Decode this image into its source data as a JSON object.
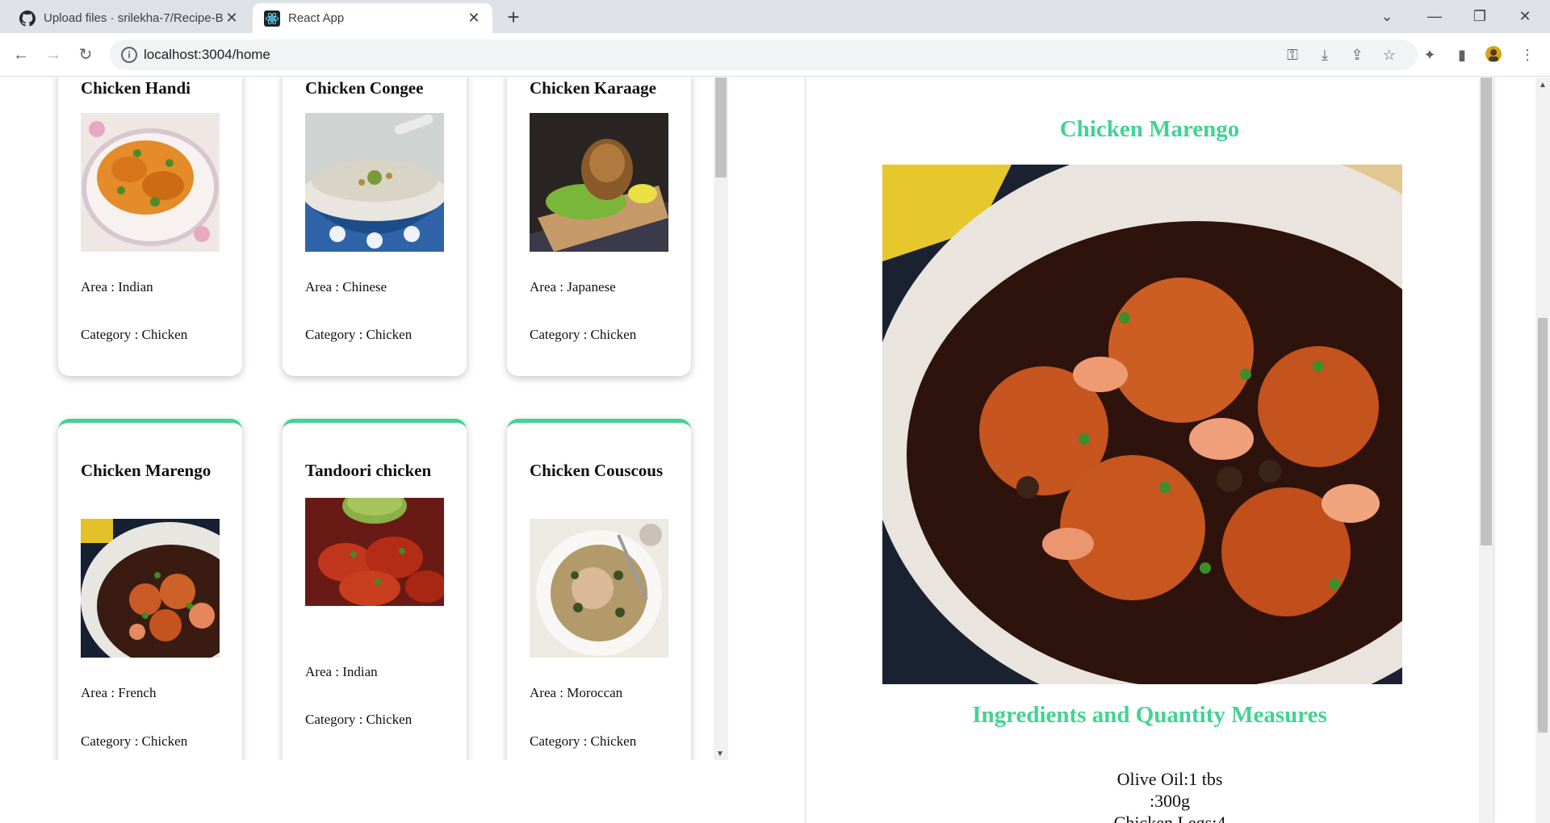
{
  "browser": {
    "tabs": [
      {
        "title": "Upload files · srilekha-7/Recipe-B",
        "favicon": "github-icon"
      },
      {
        "title": "React App",
        "favicon": "react-icon"
      }
    ],
    "url": "localhost:3004/home",
    "url_host": "localhost",
    "url_path": ":3004/home"
  },
  "cards": [
    {
      "name": "Chicken Handi",
      "area": "Area : Indian",
      "category": "Category : Chicken"
    },
    {
      "name": "Chicken Congee",
      "area": "Area : Chinese",
      "category": "Category : Chicken"
    },
    {
      "name": "Chicken Karaage",
      "area": "Area : Japanese",
      "category": "Category : Chicken"
    },
    {
      "name": "Chicken Marengo",
      "area": "Area : French",
      "category": "Category : Chicken"
    },
    {
      "name": "Tandoori chicken",
      "area": "Area : Indian",
      "category": "Category : Chicken"
    },
    {
      "name": "Chicken Couscous",
      "area": "Area : Moroccan",
      "category": "Category : Chicken"
    }
  ],
  "detail": {
    "title": "Chicken Marengo",
    "ingredients_heading": "Ingredients and Quantity Measures",
    "ingredients": [
      "Olive Oil:1 tbs",
      ":300g",
      "Chicken Legs:4"
    ]
  },
  "colors": {
    "accent": "#42d392"
  }
}
